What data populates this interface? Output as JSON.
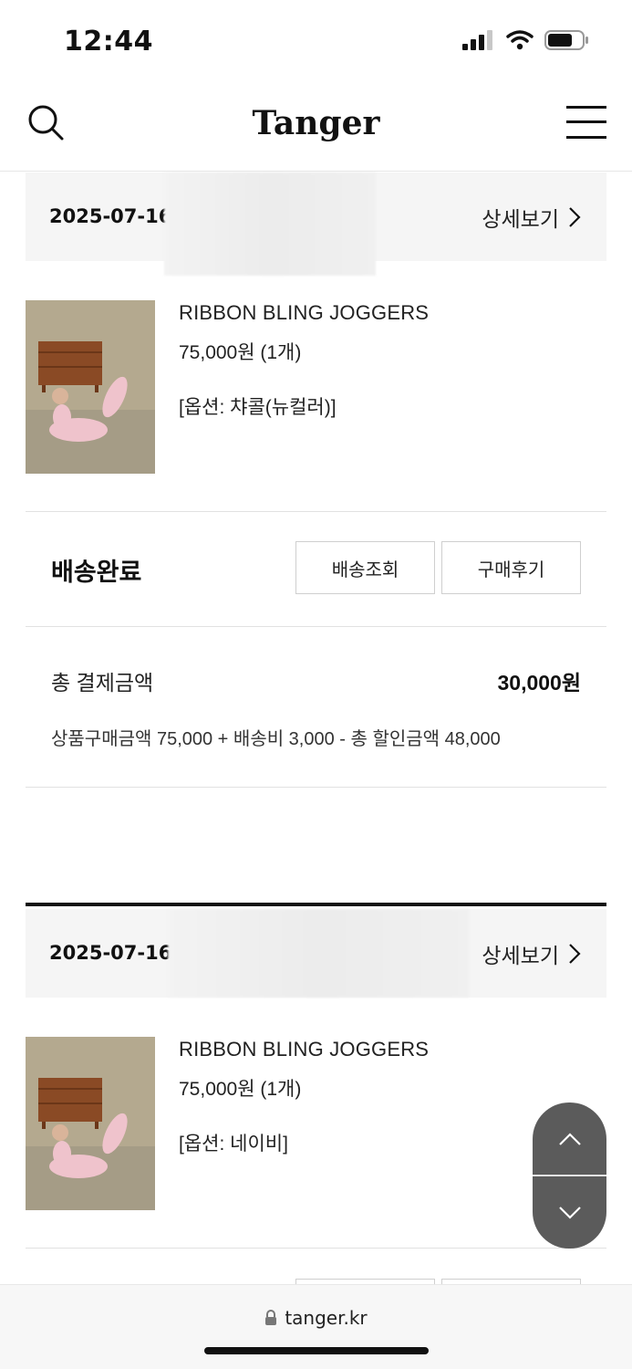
{
  "status_bar": {
    "time": "12:44"
  },
  "header": {
    "logo": "Tanger",
    "search_icon": "search-icon",
    "menu_icon": "hamburger-menu-icon"
  },
  "orders": [
    {
      "date": "2025-07-16",
      "detail_label": "상세보기",
      "product": {
        "name": "RIBBON BLING JOGGERS",
        "price": "75,000원 (1개)",
        "option": "[옵션: 챠콜(뉴컬러)]"
      },
      "status": "배송완료",
      "buttons": {
        "track": "배송조회",
        "review": "구매후기"
      },
      "total": {
        "label": "총 결제금액",
        "value": "30,000원",
        "breakdown": "상품구매금액 75,000 + 배송비 3,000 - 총 할인금액 48,000"
      }
    },
    {
      "date": "2025-07-16",
      "detail_label": "상세보기",
      "product": {
        "name": "RIBBON BLING JOGGERS",
        "price": "75,000원 (1개)",
        "option": "[옵션: 네이비]"
      }
    }
  ],
  "scroll_controls": {
    "up_icon": "chevron-up-icon",
    "down_icon": "chevron-down-icon"
  },
  "browser": {
    "url": "tanger.kr",
    "lock_icon": "lock-icon"
  }
}
